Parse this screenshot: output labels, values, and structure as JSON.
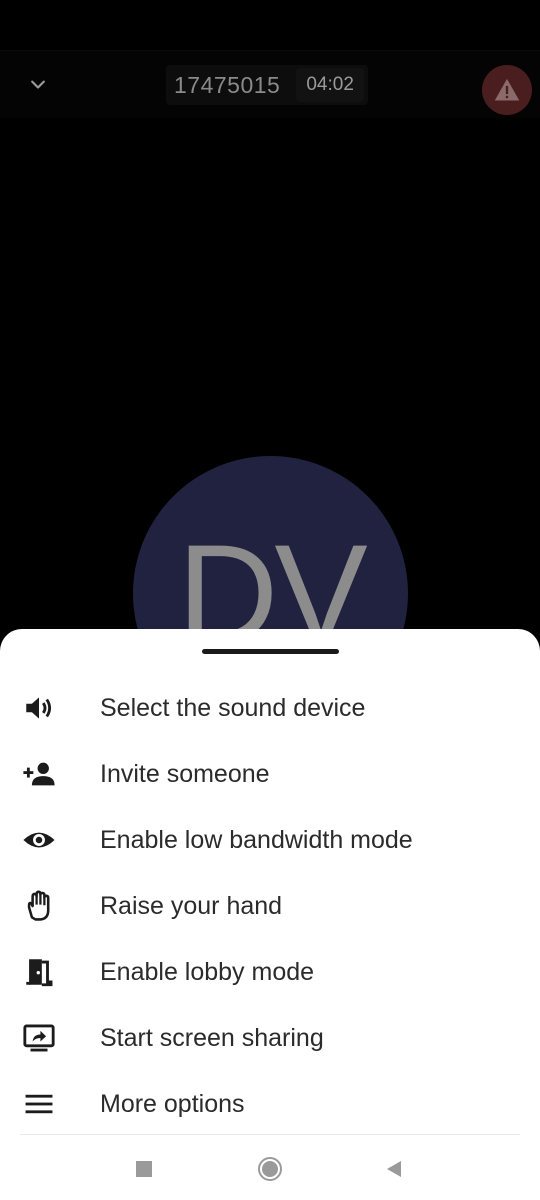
{
  "header": {
    "meeting_id": "17475015",
    "timer": "04:02"
  },
  "participant": {
    "initials": "DV"
  },
  "menu": {
    "items": [
      {
        "label": "Select the sound device",
        "icon": "speaker-icon"
      },
      {
        "label": "Invite someone",
        "icon": "add-person-icon"
      },
      {
        "label": "Enable low bandwidth mode",
        "icon": "eye-icon"
      },
      {
        "label": "Raise your hand",
        "icon": "hand-icon"
      },
      {
        "label": "Enable lobby mode",
        "icon": "door-icon"
      },
      {
        "label": "Start screen sharing",
        "icon": "screen-share-icon"
      },
      {
        "label": "More options",
        "icon": "menu-icon"
      }
    ]
  },
  "colors": {
    "avatar_bg": "#21223f",
    "warning_bg": "#4a1e1e",
    "sheet_bg": "#ffffff",
    "text": "#2b2b2b"
  }
}
